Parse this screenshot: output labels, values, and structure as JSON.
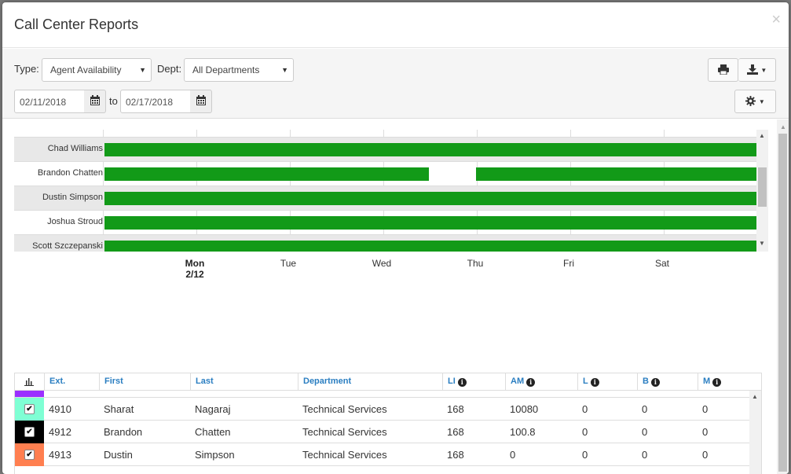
{
  "title": "Call Center Reports",
  "close_symbol": "×",
  "filters": {
    "type_label": "Type:",
    "type_value": "Agent Availability",
    "dept_label": "Dept:",
    "dept_value": "All Departments",
    "date_from": "02/11/2018",
    "to_label": "to",
    "date_to": "02/17/2018"
  },
  "timeline": {
    "agents": [
      "Chad Williams",
      "Brandon Chatten",
      "Dustin Simpson",
      "Joshua Stroud",
      "Scott Szczepanski"
    ],
    "days": [
      {
        "name": "Mon",
        "date": "2/12"
      },
      {
        "name": "Tue",
        "date": ""
      },
      {
        "name": "Wed",
        "date": ""
      },
      {
        "name": "Thu",
        "date": ""
      },
      {
        "name": "Fri",
        "date": ""
      },
      {
        "name": "Sat",
        "date": ""
      }
    ],
    "availability_color": "#129a18"
  },
  "table": {
    "columns": [
      "Ext.",
      "First",
      "Last",
      "Department",
      "LI",
      "AM",
      "L",
      "B",
      "M"
    ],
    "rows": [
      {
        "color": "#7fffd4",
        "checked": "✔",
        "ext": "4910",
        "first": "Sharat",
        "last": "Nagaraj",
        "department": "Technical Services",
        "li": "168",
        "am": "10080",
        "l": "0",
        "b": "0",
        "m": "0"
      },
      {
        "color": "#000000",
        "checked": "✔",
        "ext": "4912",
        "first": "Brandon",
        "last": "Chatten",
        "department": "Technical Services",
        "li": "168",
        "am": "100.8",
        "l": "0",
        "b": "0",
        "m": "0"
      },
      {
        "color": "#ff7f50",
        "checked": "✔",
        "ext": "4913",
        "first": "Dustin",
        "last": "Simpson",
        "department": "Technical Services",
        "li": "168",
        "am": "0",
        "l": "0",
        "b": "0",
        "m": "0"
      }
    ],
    "partial_row_color": "#9b30ff"
  }
}
